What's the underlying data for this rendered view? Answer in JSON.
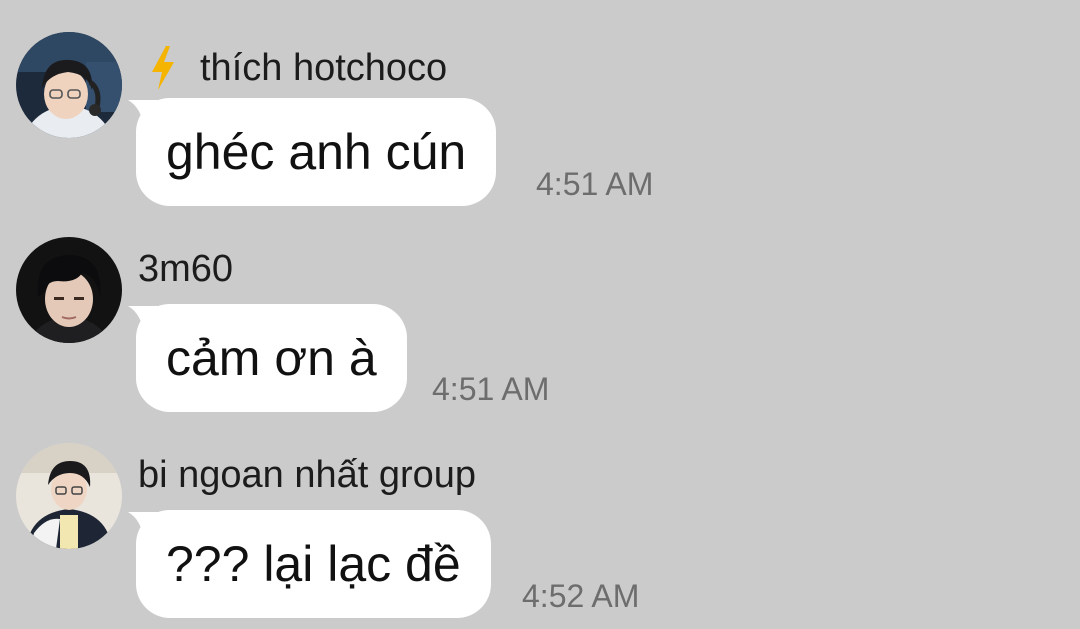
{
  "messages": [
    {
      "sender": "thích hotchoco",
      "badge_icon": "lightning-bolt-icon",
      "text": "ghéc anh cún",
      "time": "4:51 AM"
    },
    {
      "sender": "3m60",
      "text": "cảm ơn à",
      "time": "4:51 AM"
    },
    {
      "sender": "bi ngoan nhất group",
      "text": "??? lại lạc đề",
      "time": "4:52 AM"
    }
  ],
  "colors": {
    "background": "#cbcbcb",
    "bubble": "#ffffff",
    "timestamp": "#6d6d6d",
    "bolt": "#f4b400"
  }
}
